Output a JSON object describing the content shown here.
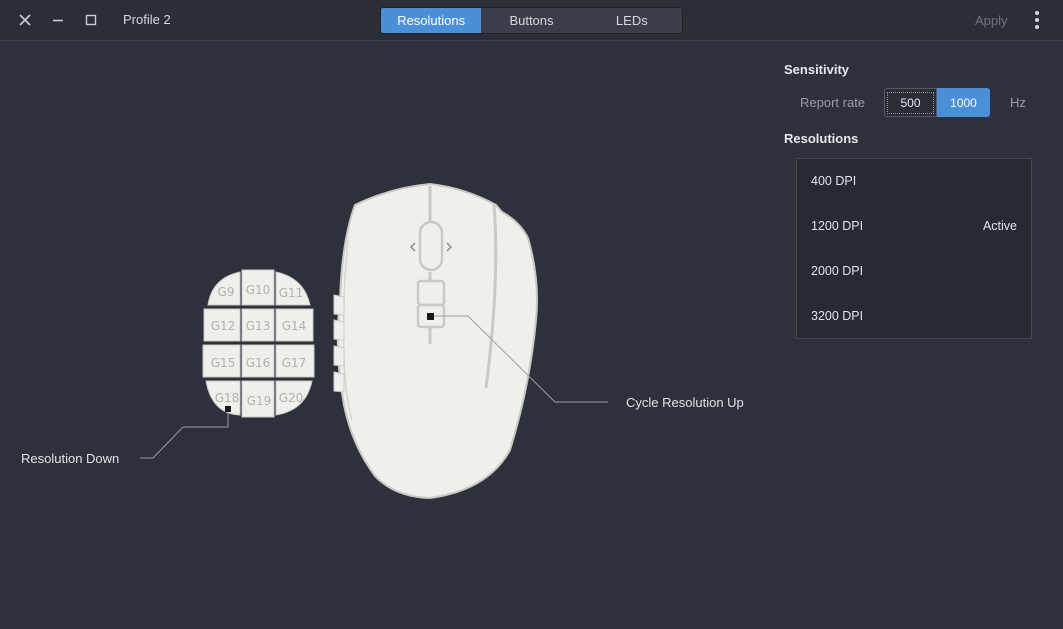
{
  "window": {
    "title": "Profile 2",
    "close_icon": "close-icon",
    "minimize_icon": "minimize-icon",
    "maximize_icon": "maximize-icon",
    "apply_label": "Apply",
    "menu_icon": "vertical-dots-icon"
  },
  "tabs": [
    {
      "label": "Resolutions",
      "active": true
    },
    {
      "label": "Buttons",
      "active": false
    },
    {
      "label": "LEDs",
      "active": false
    }
  ],
  "sensitivity": {
    "heading": "Sensitivity",
    "report_rate_label": "Report rate",
    "rates": [
      {
        "label": "500",
        "active": false
      },
      {
        "label": "1000",
        "active": true
      }
    ],
    "unit": "Hz"
  },
  "resolutions": {
    "heading": "Resolutions",
    "items": [
      {
        "dpi": "400 DPI",
        "state": ""
      },
      {
        "dpi": "1200 DPI",
        "state": "Active"
      },
      {
        "dpi": "2000 DPI",
        "state": ""
      },
      {
        "dpi": "3200 DPI",
        "state": ""
      }
    ]
  },
  "mouse": {
    "side_buttons": [
      "G9",
      "G10",
      "G11",
      "G12",
      "G13",
      "G14",
      "G15",
      "G16",
      "G17",
      "G18",
      "G19",
      "G20"
    ],
    "callouts": {
      "left": "Resolution Down",
      "right": "Cycle Resolution Up"
    }
  },
  "colors": {
    "accent": "#4a90d9",
    "background": "#2e313b",
    "titlebar": "#2b2e37",
    "mouse_fill": "#efefeb"
  }
}
